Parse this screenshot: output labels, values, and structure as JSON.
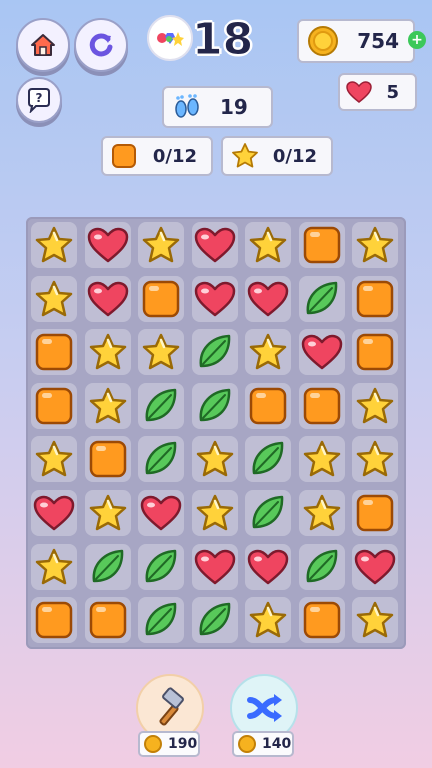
{
  "level": {
    "number": "18"
  },
  "moves": {
    "value": "19"
  },
  "coins": {
    "value": "754"
  },
  "lives": {
    "value": "5"
  },
  "goals": [
    {
      "icon": "orange-square",
      "text": "0/12"
    },
    {
      "icon": "star",
      "text": "0/12"
    }
  ],
  "board": {
    "rows": [
      [
        "star",
        "heart",
        "star",
        "heart",
        "star",
        "orange",
        "star"
      ],
      [
        "star",
        "heart",
        "orange",
        "heart",
        "heart",
        "leaf",
        "orange"
      ],
      [
        "orange",
        "star",
        "star",
        "leaf",
        "star",
        "heart",
        "orange"
      ],
      [
        "orange",
        "star",
        "leaf",
        "leaf",
        "orange",
        "orange",
        "star"
      ],
      [
        "star",
        "orange",
        "leaf",
        "star",
        "leaf",
        "star",
        "star"
      ],
      [
        "heart",
        "star",
        "heart",
        "star",
        "leaf",
        "star",
        "orange"
      ],
      [
        "star",
        "leaf",
        "leaf",
        "heart",
        "heart",
        "leaf",
        "heart"
      ],
      [
        "orange",
        "orange",
        "leaf",
        "leaf",
        "star",
        "orange",
        "star"
      ]
    ]
  },
  "boosters": [
    {
      "icon": "hammer-icon",
      "cost": "190"
    },
    {
      "icon": "shuffle-icon",
      "cost": "140"
    }
  ],
  "colors": {
    "star": "#ffd23a",
    "heart": "#ef4560",
    "orange": "#ff9a1f",
    "leaf": "#58c95a",
    "board": "#a7a6c4"
  }
}
